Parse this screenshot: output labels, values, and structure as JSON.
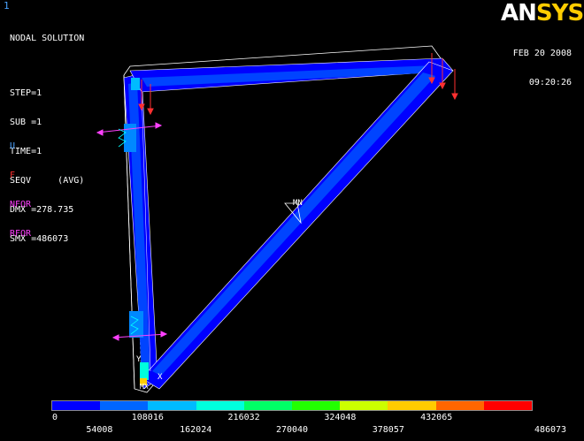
{
  "window": {
    "number": "1"
  },
  "brand": {
    "logo_prefix": "AN",
    "logo_suffix": "SYS"
  },
  "header": {
    "date": "FEB 20 2008",
    "time": "09:20:26"
  },
  "solution": {
    "title": "NODAL SOLUTION",
    "step": "STEP=1",
    "sub": "SUB =1",
    "time": "TIME=1",
    "result": "SEQV     (AVG)",
    "dmx": "DMX =278.735",
    "smx": "SMX =486073"
  },
  "symbols": [
    {
      "label": "U",
      "color": "#4aa3ff"
    },
    {
      "label": "F",
      "color": "#ff3030"
    },
    {
      "label": "NFOR",
      "color": "#ff40ff"
    },
    {
      "label": "RFOR",
      "color": "#ff40ff"
    }
  ],
  "markers": {
    "mn": "MN",
    "mx": "MX",
    "axis_x": "X",
    "axis_y": "Y"
  },
  "contour_scale": {
    "colors": [
      "#0000ff",
      "#0066ff",
      "#00bbff",
      "#00ffdd",
      "#00ff66",
      "#22ff00",
      "#ccff00",
      "#ffcc00",
      "#ff6600",
      "#ff0000"
    ],
    "upper_labels": [
      "0",
      "108016",
      "216032",
      "324048",
      "432065"
    ],
    "lower_labels": [
      "54008",
      "162024",
      "270040",
      "378057",
      "486073"
    ]
  }
}
